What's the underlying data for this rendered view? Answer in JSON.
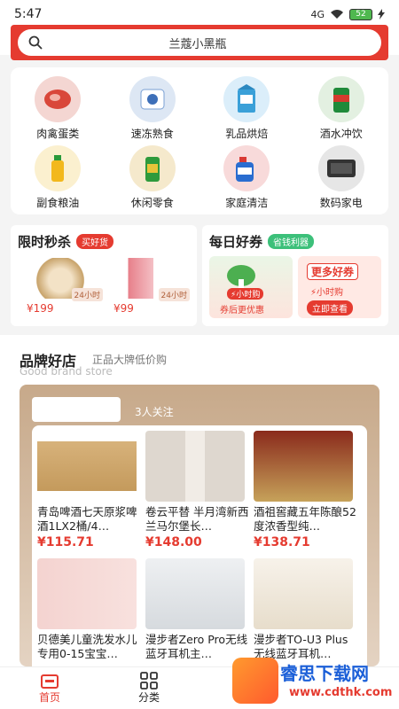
{
  "status": {
    "time": "5:47",
    "signal": "4G",
    "battery": "52"
  },
  "search": {
    "text": "兰蔻小黑瓶"
  },
  "categories": [
    {
      "label": "肉禽蛋类",
      "icon": "meat-icon",
      "color": "#f4d6d2"
    },
    {
      "label": "速冻熟食",
      "icon": "frozen-food-icon",
      "color": "#dde7f4"
    },
    {
      "label": "乳品烘焙",
      "icon": "milk-icon",
      "color": "#dbeefa"
    },
    {
      "label": "酒水冲饮",
      "icon": "drink-icon",
      "color": "#e3f0e1"
    },
    {
      "label": "副食粮油",
      "icon": "oil-icon",
      "color": "#fbf0cf"
    },
    {
      "label": "休闲零食",
      "icon": "snack-icon",
      "color": "#f5e9cc"
    },
    {
      "label": "家庭清洁",
      "icon": "cleaning-icon",
      "color": "#f8dada"
    },
    {
      "label": "数码家电",
      "icon": "appliance-icon",
      "color": "#e6e6e6"
    }
  ],
  "flash_sale": {
    "title": "限时秒杀",
    "tag": "买好货",
    "items": [
      {
        "price": "¥199",
        "badge": "24小时"
      },
      {
        "price": "¥99",
        "badge": "24小时"
      }
    ]
  },
  "coupons": {
    "title": "每日好券",
    "tag": "省钱利器",
    "left_label": "券后更优惠",
    "left_badge": "⚡小时购",
    "right_title": "更多好券",
    "right_badge": "⚡小时购",
    "right_button": "立即查看"
  },
  "brand": {
    "title": "品牌好店",
    "subtitle": "正品大牌低价购",
    "subtitle_en": "Good brand store",
    "followers": "3人关注",
    "products": [
      {
        "name": "青岛啤酒七天原浆啤酒1LX2桶/4…",
        "price": "¥115.71"
      },
      {
        "name": "卷云平替 半月湾新西兰马尔堡长…",
        "price": "¥148.00"
      },
      {
        "name": "酒祖窖藏五年陈酿52度浓香型纯…",
        "price": "¥138.71"
      },
      {
        "name": "贝德美儿童洗发水儿专用0-15宝宝…",
        "price": ""
      },
      {
        "name": "漫步者Zero Pro无线蓝牙耳机主…",
        "price": ""
      },
      {
        "name": "漫步者TO-U3 Plus无线蓝牙耳机…",
        "price": ""
      }
    ]
  },
  "tabbar": {
    "home": "首页",
    "category": "分类"
  },
  "watermark": {
    "text": "睿思下载网",
    "url": "www.cdthk.com"
  }
}
